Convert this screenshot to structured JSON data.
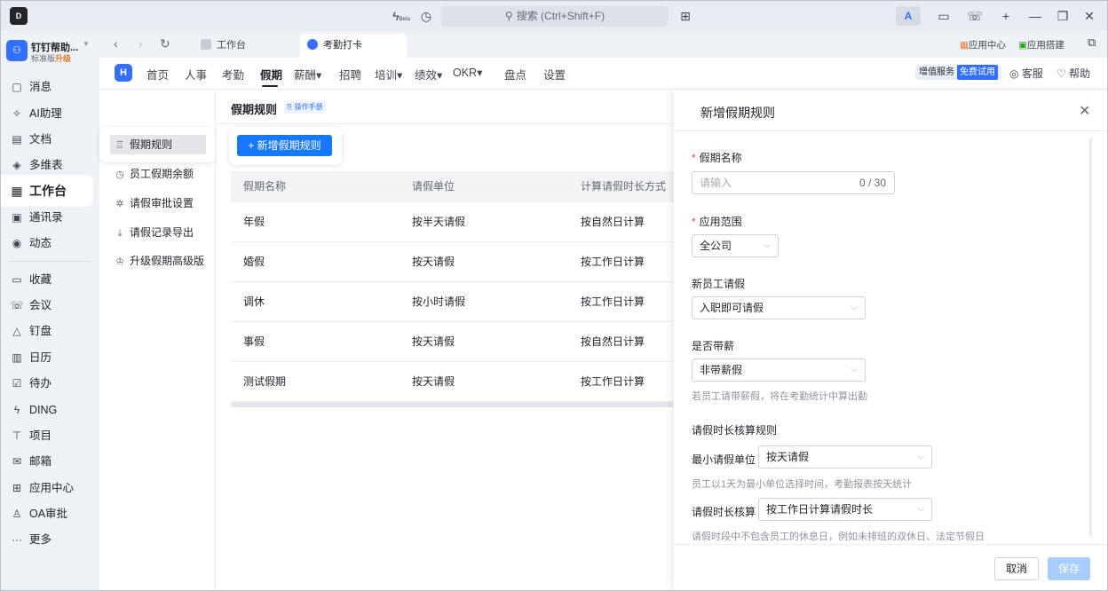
{
  "titlebar": {
    "app_logo": "D",
    "beta_label": "Beta",
    "search_placeholder": "搜索 (Ctrl+Shift+F)",
    "ai_label": "A",
    "window_controls": [
      "minimize-icon",
      "restore-icon",
      "close-icon"
    ]
  },
  "org": {
    "name": "钉钉帮助...",
    "edition": "标准版",
    "upgrade": "升级"
  },
  "leftnav": {
    "items": [
      {
        "label": "消息",
        "icon": "message-icon",
        "glyph": "▢"
      },
      {
        "label": "AI助理",
        "icon": "ai-assistant-icon",
        "glyph": "✧"
      },
      {
        "label": "文档",
        "icon": "document-icon",
        "glyph": "▤"
      },
      {
        "label": "多维表",
        "icon": "multi-table-icon",
        "glyph": "◈"
      },
      {
        "label": "工作台",
        "icon": "workbench-icon",
        "glyph": "▦"
      },
      {
        "label": "通讯录",
        "icon": "contacts-icon",
        "glyph": "▣"
      },
      {
        "label": "动态",
        "icon": "feed-icon",
        "glyph": "◉"
      },
      {
        "label": "收藏",
        "icon": "favorites-icon",
        "glyph": "▭"
      },
      {
        "label": "会议",
        "icon": "meeting-icon",
        "glyph": "☏"
      },
      {
        "label": "钉盘",
        "icon": "drive-icon",
        "glyph": "△"
      },
      {
        "label": "日历",
        "icon": "calendar-icon",
        "glyph": "▥"
      },
      {
        "label": "待办",
        "icon": "todo-icon",
        "glyph": "☑"
      },
      {
        "label": "DING",
        "icon": "ding-icon",
        "glyph": "ϟ"
      },
      {
        "label": "项目",
        "icon": "project-icon",
        "glyph": "⊤"
      },
      {
        "label": "邮箱",
        "icon": "mail-icon",
        "glyph": "✉"
      },
      {
        "label": "应用中心",
        "icon": "app-center-icon",
        "glyph": "⊞"
      },
      {
        "label": "OA审批",
        "icon": "approval-icon",
        "glyph": "♙"
      },
      {
        "label": "更多",
        "icon": "more-icon",
        "glyph": "···"
      }
    ]
  },
  "tabs": [
    {
      "label": "工作台",
      "active": false
    },
    {
      "label": "考勤打卡",
      "active": true
    }
  ],
  "tabbar_right": {
    "app_center": "应用中心",
    "app_build": "应用搭建"
  },
  "app_menu": {
    "items": [
      "首页",
      "人事",
      "考勤",
      "假期",
      "薪酬▾",
      "招聘",
      "培训▾",
      "绩效▾",
      "OKR▾",
      "盘点",
      "设置"
    ],
    "active_index": 3,
    "value_added": "增值服务",
    "free_trial": "免费试用",
    "customer_service": "客服",
    "help": "帮助"
  },
  "submenu": {
    "items": [
      {
        "label": "假期规则",
        "icon": "rule-icon",
        "glyph": "♖"
      },
      {
        "label": "员工假期余额",
        "icon": "clock-icon",
        "glyph": "◷"
      },
      {
        "label": "请假审批设置",
        "icon": "gear-icon",
        "glyph": "✲"
      },
      {
        "label": "请假记录导出",
        "icon": "download-icon",
        "glyph": "⤓"
      },
      {
        "label": "升级假期高级版",
        "icon": "crown-icon",
        "glyph": "♔"
      }
    ]
  },
  "main": {
    "title": "假期规则",
    "manual": "⎘ 操作手册",
    "add_button": "+ 新增假期规则",
    "columns": [
      "假期名称",
      "请假单位",
      "计算请假时长方式"
    ],
    "rows": [
      [
        "年假",
        "按半天请假",
        "按自然日计算"
      ],
      [
        "婚假",
        "按天请假",
        "按工作日计算"
      ],
      [
        "调休",
        "按小时请假",
        "按工作日计算"
      ],
      [
        "事假",
        "按天请假",
        "按自然日计算"
      ],
      [
        "测试假期",
        "按天请假",
        "按工作日计算"
      ]
    ]
  },
  "drawer": {
    "title": "新增假期规则",
    "name_label": "假期名称",
    "name_placeholder": "请输入",
    "name_counter": "0 / 30",
    "scope_label": "应用范围",
    "scope_value": "全公司",
    "new_employee_label": "新员工请假",
    "new_employee_value": "入职即可请假",
    "paid_label": "是否带薪",
    "paid_value": "非带薪假",
    "paid_hint": "若员工请带薪假，将在考勤统计中算出勤",
    "duration_rule_label": "请假时长核算规则",
    "min_unit_label": "最小请假单位",
    "min_unit_value": "按天请假",
    "min_unit_hint": "员工以1天为最小单位选择时间，考勤报表按天统计",
    "calc_label": "请假时长核算",
    "calc_value": "按工作日计算请假时长",
    "calc_hint": "请假时段中不包含员工的休息日，例如未排班的双休日、法定节假日",
    "cancel": "取消",
    "save": "保存"
  },
  "colors": {
    "primary": "#1677ff",
    "accent": "#3370ff",
    "required": "#f54a45",
    "save_disabled": "#a6cdfd",
    "upgrade": "#e8792b"
  }
}
